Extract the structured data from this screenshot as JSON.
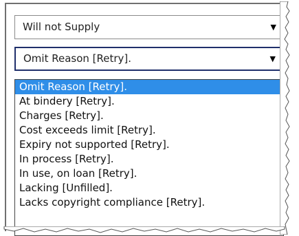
{
  "supply_select": {
    "value": "Will not Supply",
    "arrow": "▼"
  },
  "reason_select": {
    "value": "Omit Reason [Retry].",
    "arrow": "▼"
  },
  "reason_options": [
    "Omit Reason [Retry].",
    "At bindery [Retry].",
    "Charges [Retry].",
    "Cost exceeds limit [Retry].",
    "Expiry not supported [Retry].",
    "In process [Retry].",
    "In use, on loan [Retry].",
    "Lacking [Unfilled].",
    "Lacks copyright compliance [Retry]."
  ],
  "selected_option_index": 0,
  "colors": {
    "highlight": "#2f8ee8",
    "focus_border": "#1f2f6b"
  }
}
